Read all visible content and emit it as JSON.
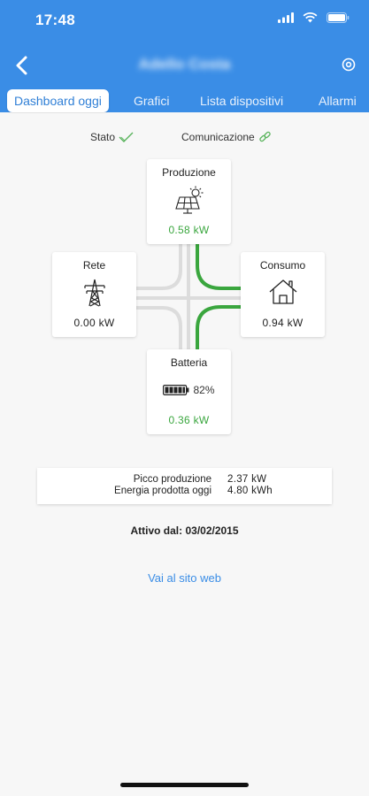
{
  "status_bar": {
    "time": "17:48"
  },
  "nav": {
    "title": "Adello Costa"
  },
  "tabs": [
    {
      "label": "Dashboard oggi",
      "active": true
    },
    {
      "label": "Grafici",
      "active": false
    },
    {
      "label": "Lista dispositivi",
      "active": false
    },
    {
      "label": "Allarmi",
      "active": false
    }
  ],
  "status": {
    "stato_label": "Stato",
    "comunicazione_label": "Comunicazione"
  },
  "cards": {
    "produzione": {
      "title": "Produzione",
      "value": "0.58 kW",
      "icon": "solar-panel-icon"
    },
    "rete": {
      "title": "Rete",
      "value": "0.00 kW",
      "icon": "power-tower-icon"
    },
    "consumo": {
      "title": "Consumo",
      "value": "0.94 kW",
      "icon": "house-icon"
    },
    "batteria": {
      "title": "Batteria",
      "value": "0.36 kW",
      "level": "82%",
      "icon": "battery-icon"
    }
  },
  "summary": {
    "peak_label": "Picco produzione",
    "peak_value": "2.37 kW",
    "energy_label": "Energia prodotta oggi",
    "energy_value": "4.80 kWh"
  },
  "active_since": {
    "label": "Attivo dal:",
    "date": "03/02/2015"
  },
  "link": {
    "label": "Vai al sito web"
  },
  "colors": {
    "header": "#3a8de6",
    "flow_active": "#3aa63e",
    "flow_idle": "#dcdcdc",
    "link": "#3a8de6"
  }
}
